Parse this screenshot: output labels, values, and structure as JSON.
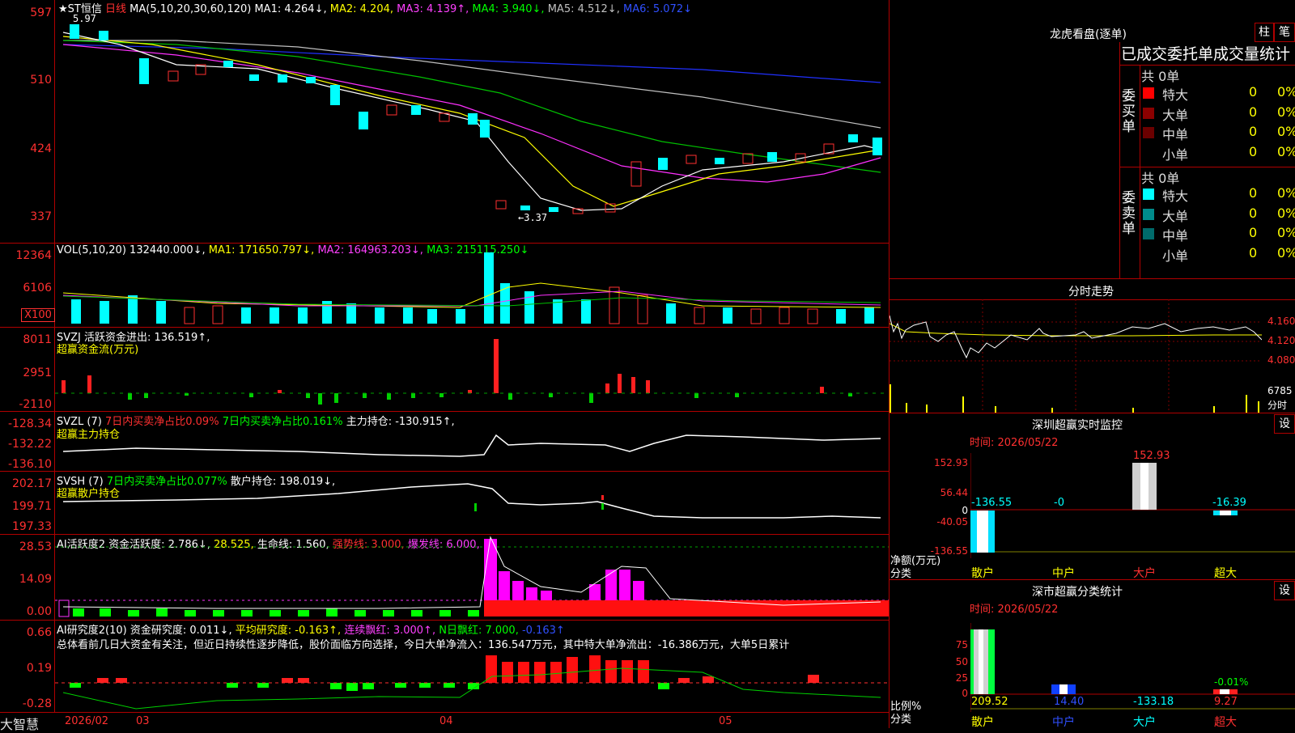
{
  "main_chart": {
    "star": "★",
    "stock_name": "ST恒信",
    "period": "日线",
    "ma_params": "MA(5,10,20,30,60,120)",
    "ma1": "MA1: 4.264↓,",
    "ma2": "MA2: 4.204,",
    "ma3": "MA3: 4.139↑,",
    "ma4": "MA4: 3.940↓,",
    "ma5": "MA5: 4.512↓,",
    "ma6": "MA6: 5.072↓",
    "high_note": "5.97",
    "low_note": "←3.37",
    "y_ticks": [
      "597",
      "510",
      "424",
      "337"
    ]
  },
  "vol_panel": {
    "label": "VOL(5,10,20)",
    "vol": "132440.000↓,",
    "ma1": "MA1: 171650.797↓,",
    "ma2": "MA2: 164963.203↓,",
    "ma3": "MA3: 215115.250↓",
    "y_ticks": [
      "12364",
      "6106"
    ],
    "unit": "X100"
  },
  "svzj_panel": {
    "label": "SVZJ",
    "text": "活跃资金进出: 136.519↑,",
    "subtitle": "超赢资金流(万元)",
    "y_ticks": [
      "8011",
      "2951",
      "-2110"
    ]
  },
  "svzl_panel": {
    "label": "SVZL (7)",
    "buy": "7日内买卖净占比0.09%",
    "buy2": "7日内买卖净占比0.161%",
    "hold": "主力持仓: -130.915↑,",
    "subtitle": "超赢主力持仓",
    "y_ticks": [
      "-128.34",
      "-132.22",
      "-136.10"
    ]
  },
  "svsh_panel": {
    "label": "SVSH (7)",
    "buy": "7日内买卖净占比0.077%",
    "hold": "散户持仓: 198.019↓,",
    "subtitle": "超赢散户持仓",
    "y_ticks": [
      "202.17",
      "199.71",
      "197.33"
    ]
  },
  "ai_active_panel": {
    "label": "AI活跃度2",
    "active": "资金活跃度: 2.786↓,",
    "val2": "28.525,",
    "life": "生命线: 1.560,",
    "strong": "强势线: 3.000,",
    "burst": "爆发线: 6.000,",
    "y_ticks": [
      "28.53",
      "14.09",
      "0.00"
    ]
  },
  "ai_research_panel": {
    "label": "AI研究度2(10)",
    "research": "资金研究度: 0.011↓,",
    "avg": "平均研究度: -0.163↑,",
    "cont": "连续飘红: 3.000↑,",
    "nday": "N日飘红: 7.000,",
    "last": "-0.163↑",
    "summary": "总体看前几日大资金有关注，但近日持续性逐步降低，股价面临方向选择，今日大单净流入：136.547万元，其中特大单净流出：-16.386万元，大单5日累计",
    "y_ticks": [
      "0.66",
      "0.19",
      "-0.28"
    ]
  },
  "x_axis": {
    "brand": "大智慧",
    "labels": [
      "2026/02",
      "03",
      "04",
      "05"
    ]
  },
  "right_panel": {
    "dragon_title": "龙虎看盘(逐单)",
    "btn_bar": "柱",
    "btn_pen": "笔",
    "stats_title": "已成交委托单成交量统计",
    "buy_side": {
      "label": "委买单",
      "total": "共 0单",
      "rows": [
        {
          "name": "特大",
          "count": "0",
          "pct": "0%",
          "color": "#ff0000"
        },
        {
          "name": "大单",
          "count": "0",
          "pct": "0%",
          "color": "#8b0000"
        },
        {
          "name": "中单",
          "count": "0",
          "pct": "0%",
          "color": "#6b0000"
        },
        {
          "name": "小单",
          "count": "0",
          "pct": "0%",
          "color": "#000000"
        }
      ]
    },
    "sell_side": {
      "label": "委卖单",
      "total": "共 0单",
      "rows": [
        {
          "name": "特大",
          "count": "0",
          "pct": "0%",
          "color": "#00ffff"
        },
        {
          "name": "大单",
          "count": "0",
          "pct": "0%",
          "color": "#008b8b"
        },
        {
          "name": "中单",
          "count": "0",
          "pct": "0%",
          "color": "#006b6b"
        },
        {
          "name": "小单",
          "count": "0",
          "pct": "0%",
          "color": "#000000"
        }
      ]
    },
    "intraday_title": "分时走势",
    "intraday_prices": [
      "4.160",
      "4.120",
      "4.080"
    ],
    "intraday_vol": "6785",
    "intraday_vol_label": "分时",
    "sz_monitor_title": "深圳超赢实时监控",
    "sz_monitor_btn": "设",
    "sz_monitor_time": "时间: 2026/05/22",
    "sz_monitor_y": [
      "152.93",
      "56.44",
      "0",
      "-40.05",
      "-136.55"
    ],
    "sz_monitor_vals": [
      "-136.55",
      "-0",
      "152.93",
      "-16.39"
    ],
    "sz_monitor_cats": [
      "散户",
      "中户",
      "大户",
      "超大"
    ],
    "sz_monitor_left1": "净额(万元)",
    "sz_monitor_left2": "分类",
    "sz_class_title": "深市超赢分类统计",
    "sz_class_btn": "设",
    "sz_class_time": "时间: 2026/05/22",
    "sz_class_y": [
      "75",
      "50",
      "25",
      "0"
    ],
    "sz_class_vals": [
      "209.52",
      "14.40",
      "-133.18",
      "9.27"
    ],
    "sz_class_pct": "-0.01%",
    "sz_class_cats": [
      "散户",
      "中户",
      "大户",
      "超大"
    ],
    "sz_class_left1": "比例%",
    "sz_class_left2": "分类"
  }
}
